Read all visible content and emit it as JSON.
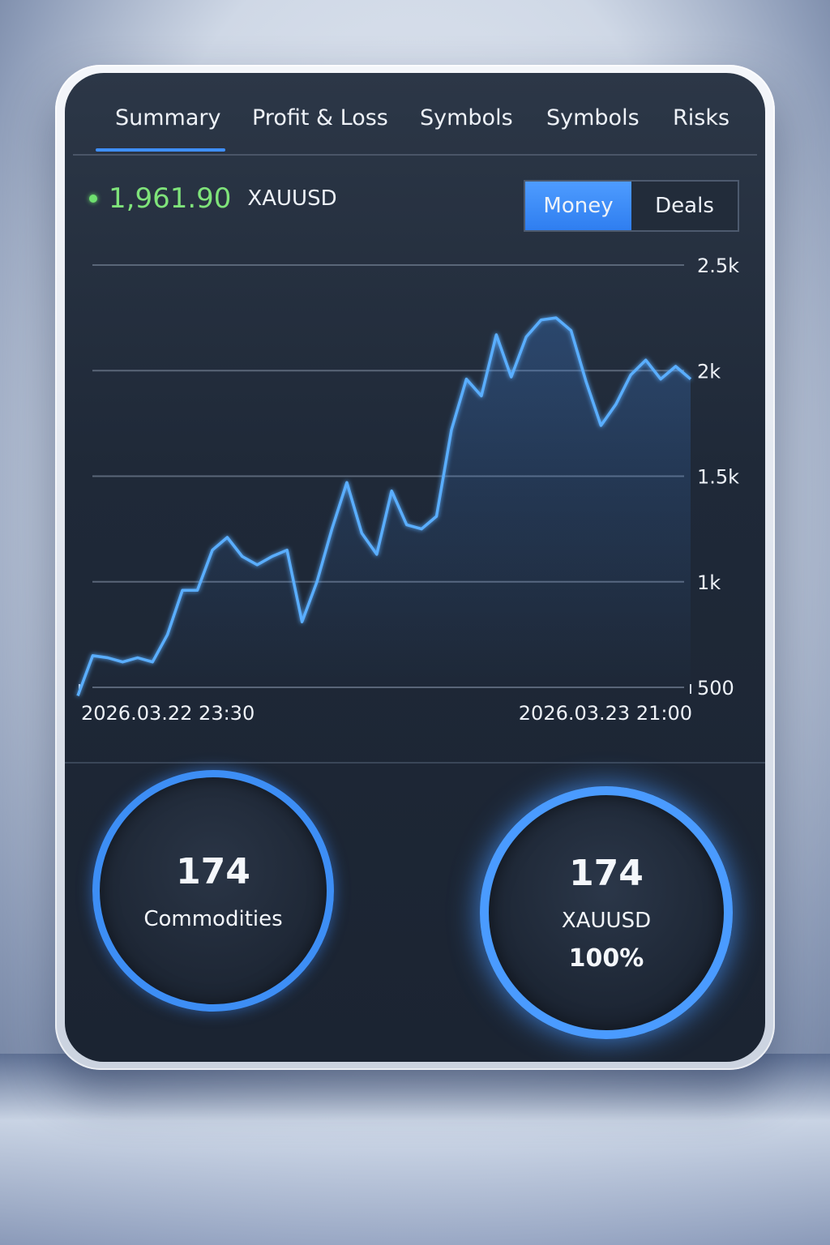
{
  "tabs": [
    {
      "label": "Summary",
      "active": true
    },
    {
      "label": "Profit & Loss",
      "active": false
    },
    {
      "label": "Symbols",
      "active": false
    },
    {
      "label": "Symbols",
      "active": false
    },
    {
      "label": "Risks",
      "active": false
    }
  ],
  "header": {
    "price": "1,961.90",
    "symbol": "XAUUSD",
    "price_color": "#7fe37a",
    "status_icon": "green-dot-icon"
  },
  "toggle": {
    "options": [
      "Money",
      "Deals"
    ],
    "selected": "Money"
  },
  "chart_data": {
    "type": "line",
    "x_start_label": "2026.03.22 23:30",
    "x_end_label": "2026.03.23 21:00",
    "yticks": [
      500,
      1000,
      1500,
      2000,
      2500
    ],
    "ytick_labels": [
      "500",
      "1k",
      "1.5k",
      "2k",
      "2.5k"
    ],
    "ylim": [
      500,
      2500
    ],
    "grid": true,
    "line_color": "#5aaeff",
    "series": [
      {
        "values": [
          460,
          650,
          640,
          620,
          640,
          620,
          750,
          960,
          960,
          1150,
          1210,
          1120,
          1080,
          1120,
          1150,
          810,
          1000,
          1250,
          1470,
          1230,
          1130,
          1430,
          1270,
          1250,
          1310,
          1720,
          1960,
          1880,
          2170,
          1970,
          2160,
          2240,
          2250,
          2190,
          1950,
          1740,
          1840,
          1980,
          2050,
          1960,
          2020,
          1960
        ]
      }
    ]
  },
  "stats": [
    {
      "value": "174",
      "label": "Commodities"
    },
    {
      "value": "174",
      "label": "XAUUSD",
      "percent": "100%"
    }
  ]
}
